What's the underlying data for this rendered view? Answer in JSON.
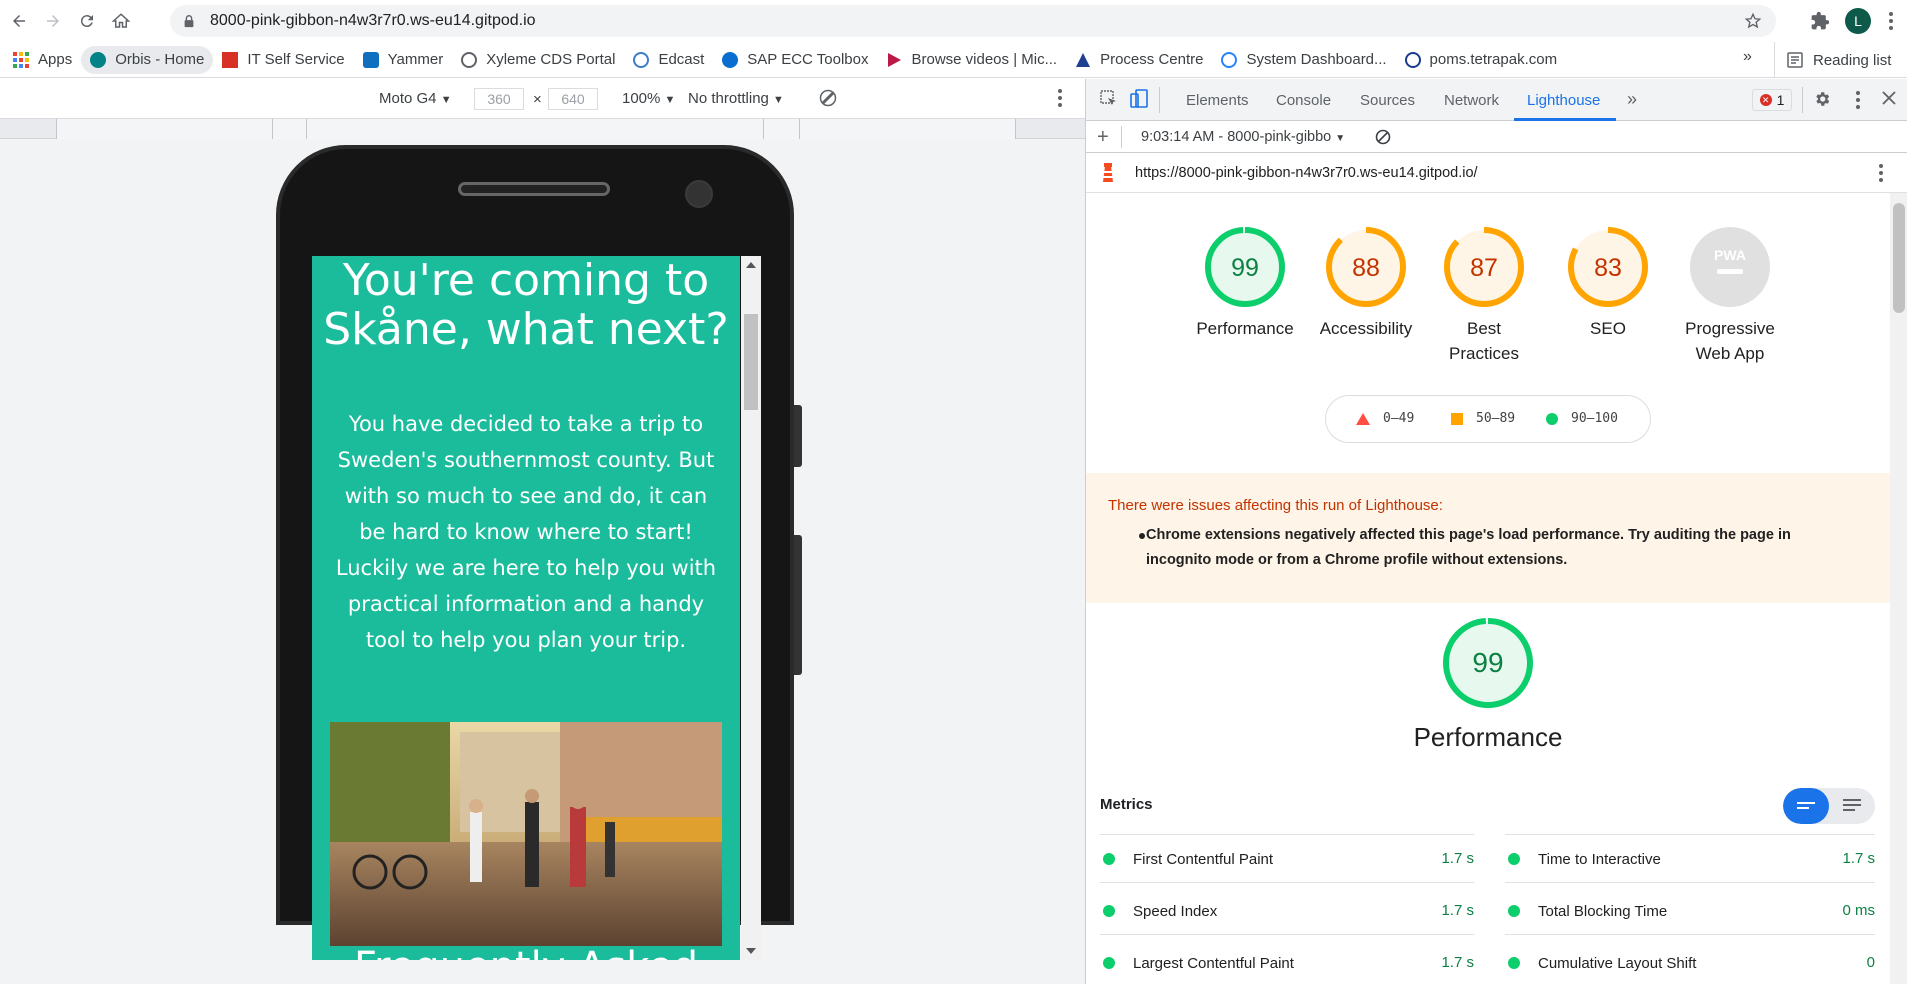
{
  "browser": {
    "url": "8000-pink-gibbon-n4w3r7r0.ws-eu14.gitpod.io",
    "profile_initial": "L",
    "bookmarks": [
      {
        "label": "Apps",
        "icon": "apps-grid-icon",
        "color": "#ea4335"
      },
      {
        "label": "Orbis - Home",
        "icon": "sharepoint-icon",
        "color": "#038387"
      },
      {
        "label": "IT Self Service",
        "icon": "servicenow-icon",
        "color": "#d93025"
      },
      {
        "label": "Yammer",
        "icon": "yammer-icon",
        "color": "#106ebe"
      },
      {
        "label": "Xyleme CDS Portal",
        "icon": "globe-icon",
        "color": "#5f6368"
      },
      {
        "label": "Edcast",
        "icon": "edcast-icon",
        "color": "#3d7cc9"
      },
      {
        "label": "SAP ECC Toolbox",
        "icon": "sap-icon",
        "color": "#0a6ed1"
      },
      {
        "label": "Browse videos | Mic...",
        "icon": "stream-icon",
        "color": "#bc1948"
      },
      {
        "label": "Process Centre",
        "icon": "process-icon",
        "color": "#1f3f91"
      },
      {
        "label": "System Dashboard...",
        "icon": "jira-icon",
        "color": "#2684ff"
      },
      {
        "label": "poms.tetrapak.com",
        "icon": "globe-icon",
        "color": "#1a3c8f"
      }
    ],
    "more_bookmarks": "»",
    "reading_list": "Reading list"
  },
  "device_toolbar": {
    "device": "Moto G4",
    "width": "360",
    "height": "640",
    "times": "×",
    "zoom": "100%",
    "throttling": "No throttling"
  },
  "site": {
    "heading": "You're coming to Skåne, what next?",
    "intro": "You have decided to take a trip to Sweden's southernmost county. But with so much to see and do, it can be hard to know where to start! Luckily we are here to help you with practical information and a handy tool to help you plan your trip.",
    "next_heading": "Frequently Asked"
  },
  "devtools": {
    "tabs": [
      "Elements",
      "Console",
      "Sources",
      "Network",
      "Lighthouse"
    ],
    "selected_tab": "Lighthouse",
    "more_tabs": "»",
    "error_count": "1",
    "report_selector": "9:03:14 AM - 8000-pink-gibbo",
    "report_url": "https://8000-pink-gibbon-n4w3r7r0.ws-eu14.gitpod.io/"
  },
  "lighthouse": {
    "scores": [
      {
        "label": "Performance",
        "score": 99,
        "color": "#0cce6b",
        "bg": "#e7f9ef",
        "text_color": "#0d8043"
      },
      {
        "label": "Accessibility",
        "score": 88,
        "color": "#ffa400",
        "bg": "#fff5e6",
        "text_color": "#c33300"
      },
      {
        "label": "Best Practices",
        "score": 87,
        "color": "#ffa400",
        "bg": "#fff5e6",
        "text_color": "#c33300"
      },
      {
        "label": "SEO",
        "score": 83,
        "color": "#ffa400",
        "bg": "#fff5e6",
        "text_color": "#c33300"
      }
    ],
    "pwa": {
      "label": "Progressive Web App",
      "badge": "PWA"
    },
    "legend": [
      "0–49",
      "50–89",
      "90–100"
    ],
    "legend_colors": [
      "#ff4e42",
      "#ffa400",
      "#0cce6b"
    ],
    "warning_title": "There were issues affecting this run of Lighthouse:",
    "warning_message": "Chrome extensions negatively affected this page's load performance. Try auditing the page in incognito mode or from a Chrome profile without extensions.",
    "performance_label": "Performance",
    "performance_score": 99,
    "metrics_title": "Metrics",
    "metrics": [
      {
        "name": "First Contentful Paint",
        "value": "1.7 s"
      },
      {
        "name": "Time to Interactive",
        "value": "1.7 s"
      },
      {
        "name": "Speed Index",
        "value": "1.7 s"
      },
      {
        "name": "Total Blocking Time",
        "value": "0 ms"
      },
      {
        "name": "Largest Contentful Paint",
        "value": "1.7 s"
      },
      {
        "name": "Cumulative Layout Shift",
        "value": "0"
      }
    ]
  }
}
